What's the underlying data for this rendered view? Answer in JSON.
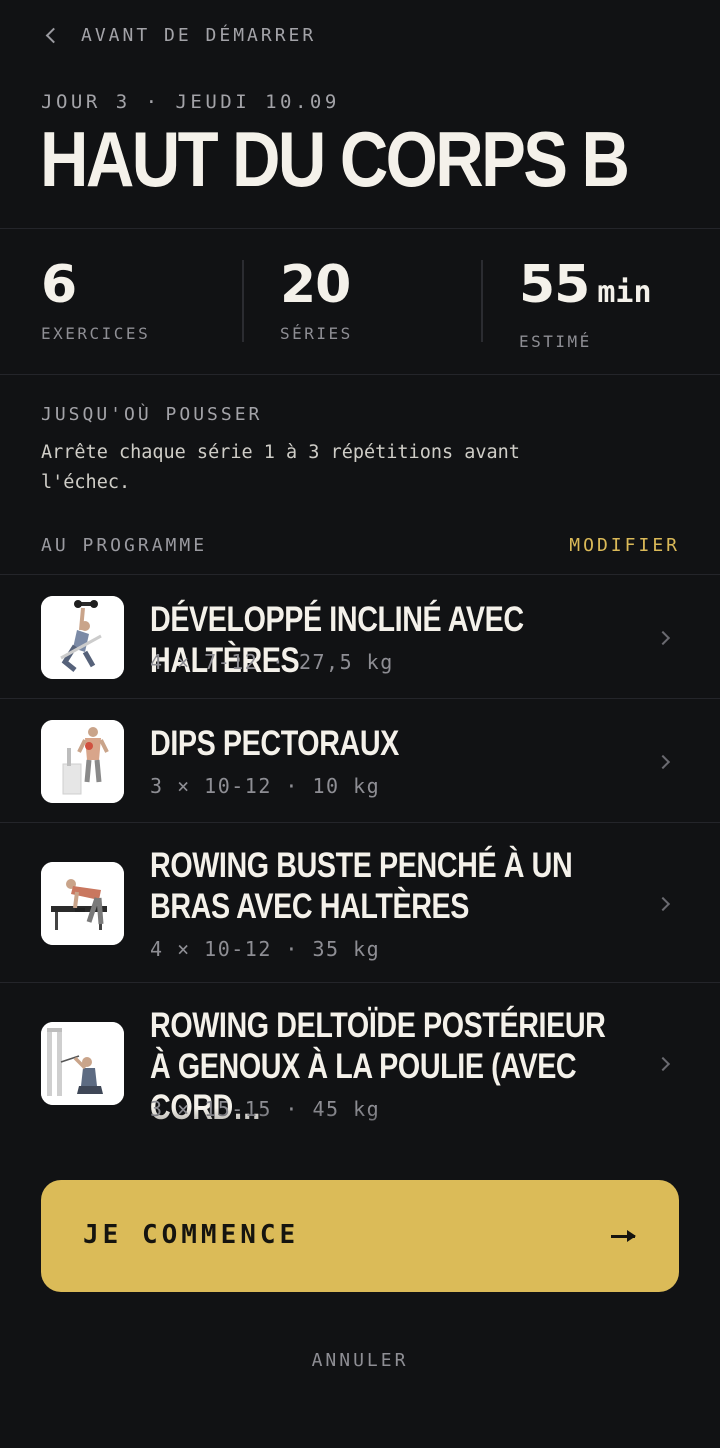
{
  "nav": {
    "back_icon": "chevron-left-icon",
    "back_label": "AVANT DE DÉMARRER"
  },
  "session": {
    "date_line": "JOUR 3 · JEUDI 10.09",
    "title": "HAUT DU CORPS B"
  },
  "stats": [
    {
      "value": "6",
      "unit": "",
      "label": "EXERCICES"
    },
    {
      "value": "20",
      "unit": "",
      "label": "SÉRIES"
    },
    {
      "value": "55",
      "unit": "min",
      "label": "ESTIMÉ"
    }
  ],
  "intensity": {
    "title": "JUSQU'OÙ POUSSER",
    "text": "Arrête chaque série 1 à 3 répétitions avant l'échec."
  },
  "program": {
    "title": "AU PROGRAMME",
    "modify_label": "MODIFIER",
    "exercises": [
      {
        "name": "DÉVELOPPÉ INCLINÉ AVEC HALTÈRES",
        "meta": "4 × 7-12 · 27,5 kg",
        "image": "incline-dumbbell-press-illustration"
      },
      {
        "name": "DIPS PECTORAUX",
        "meta": "3 × 10-12 · 10 kg",
        "image": "chest-dips-illustration"
      },
      {
        "name": "ROWING BUSTE PENCHÉ À UN BRAS AVEC HALTÈRES",
        "meta": "4 × 10-12 · 35 kg",
        "image": "one-arm-dumbbell-row-illustration"
      },
      {
        "name": "ROWING DELTOÏDE POSTÉRIEUR À GENOUX À LA POULIE (AVEC CORD…",
        "meta": "3 × 15-15 · 45 kg",
        "image": "kneeling-cable-rear-delt-row-illustration"
      }
    ]
  },
  "cta": {
    "label": "JE COMMENCE",
    "icon": "arrow-right-icon"
  },
  "cancel_label": "ANNULER",
  "colors": {
    "background": "#111214",
    "accent": "#dbbb58",
    "text": "#f4f1ea",
    "muted": "#8e8e94"
  }
}
